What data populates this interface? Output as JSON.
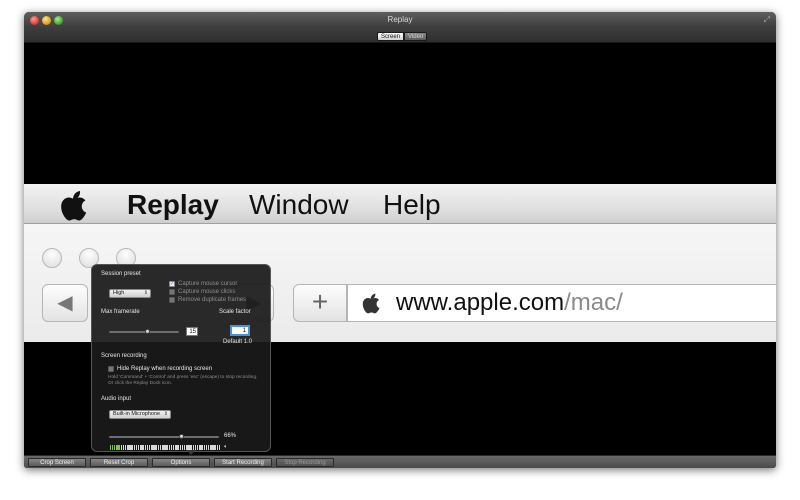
{
  "window": {
    "title": "Replay"
  },
  "mode_toggle": {
    "left": "Screen",
    "right": "Video"
  },
  "captured": {
    "menubar": {
      "app": "Replay",
      "window": "Window",
      "help": "Help"
    },
    "url": {
      "host": "www.apple.com",
      "path": "/mac/"
    }
  },
  "options": {
    "session_preset_label": "Session preset",
    "session_preset_value": "High",
    "capture_cursor": {
      "label": "Capture mouse cursor",
      "checked": true
    },
    "capture_clicks": {
      "label": "Capture mouse clicks",
      "checked": false
    },
    "remove_dupes": {
      "label": "Remove duplicate frames",
      "checked": false
    },
    "max_framerate_label": "Max framerate",
    "max_framerate_value": "15",
    "max_framerate_level": 0.55,
    "scale_factor_label": "Scale factor",
    "scale_factor_value": "1",
    "scale_default": "Default 1.0",
    "screen_recording_label": "Screen recording",
    "hide_replay": {
      "label": "Hide Replay when recording screen",
      "checked": false
    },
    "hide_note": "Hold 'Command' + 'Control' and press 'esc' (escape) to stop recording. Or click the Replay Dock icon.",
    "audio_input_label": "Audio input",
    "audio_input_value": "Built-in Microphone",
    "volume_pct": "66%",
    "volume_level": 0.66,
    "meter_level": 0.1
  },
  "toolbar": {
    "crop_screen": "Crop Screen",
    "reset_crop": "Reset Crop",
    "options": "Options",
    "start_recording": "Start Recording",
    "stop_recording": "Stop Recording"
  }
}
